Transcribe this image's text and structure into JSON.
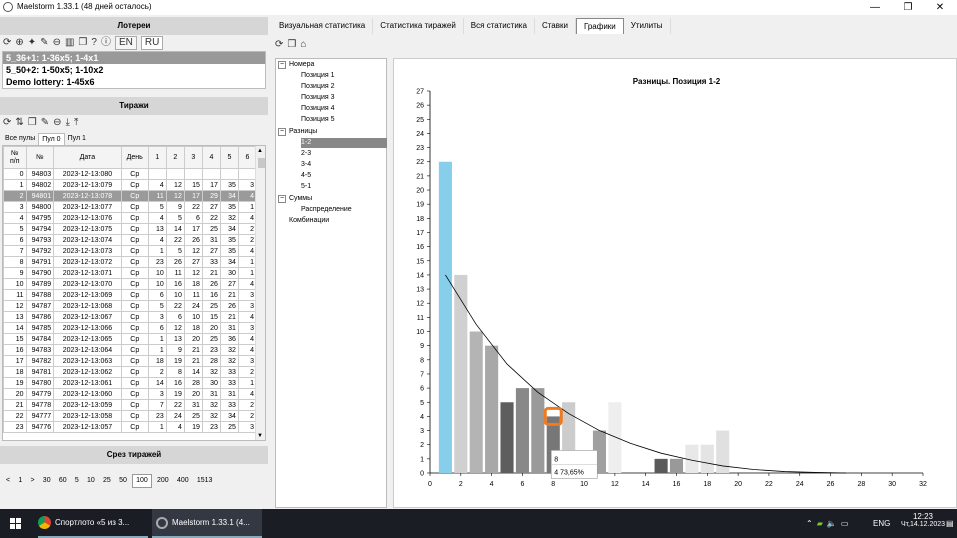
{
  "window": {
    "title": "Maelstorm 1.33.1 (48 дней осталось)",
    "min": "—",
    "max": "❐",
    "close": "✕"
  },
  "left": {
    "lotteries_header": "Лотереи",
    "lang_en": "EN",
    "lang_ru": "RU",
    "lotteries": [
      "5_36+1: 1-36x5; 1-4x1",
      "5_50+2: 1-50x5; 1-10x2",
      "Demo lottery: 1-45x6"
    ],
    "draws_header": "Тиражи",
    "pools": [
      "Все пулы",
      "Пул 0",
      "Пул 1"
    ],
    "columns": [
      "№\nп/п",
      "№",
      "Дата",
      "День",
      "1",
      "2",
      "3",
      "4",
      "5",
      "6"
    ],
    "rows": [
      [
        "0",
        "94803",
        "2023-12-13:080",
        "Ср",
        "",
        "",
        "",
        "",
        "",
        ""
      ],
      [
        "1",
        "94802",
        "2023-12-13:079",
        "Ср",
        "4",
        "12",
        "15",
        "17",
        "35",
        "3"
      ],
      [
        "2",
        "94801",
        "2023-12-13:078",
        "Ср",
        "11",
        "12",
        "17",
        "29",
        "34",
        "4"
      ],
      [
        "3",
        "94800",
        "2023-12-13:077",
        "Ср",
        "5",
        "9",
        "22",
        "27",
        "35",
        "1"
      ],
      [
        "4",
        "94795",
        "2023-12-13:076",
        "Ср",
        "4",
        "5",
        "6",
        "22",
        "32",
        "4"
      ],
      [
        "5",
        "94794",
        "2023-12-13:075",
        "Ср",
        "13",
        "14",
        "17",
        "25",
        "34",
        "2"
      ],
      [
        "6",
        "94793",
        "2023-12-13:074",
        "Ср",
        "4",
        "22",
        "26",
        "31",
        "35",
        "2"
      ],
      [
        "7",
        "94792",
        "2023-12-13:073",
        "Ср",
        "1",
        "5",
        "12",
        "27",
        "35",
        "4"
      ],
      [
        "8",
        "94791",
        "2023-12-13:072",
        "Ср",
        "23",
        "26",
        "27",
        "33",
        "34",
        "1"
      ],
      [
        "9",
        "94790",
        "2023-12-13:071",
        "Ср",
        "10",
        "11",
        "12",
        "21",
        "30",
        "1"
      ],
      [
        "10",
        "94789",
        "2023-12-13:070",
        "Ср",
        "10",
        "16",
        "18",
        "26",
        "27",
        "4"
      ],
      [
        "11",
        "94788",
        "2023-12-13:069",
        "Ср",
        "6",
        "10",
        "11",
        "16",
        "21",
        "3"
      ],
      [
        "12",
        "94787",
        "2023-12-13:068",
        "Ср",
        "5",
        "22",
        "24",
        "25",
        "26",
        "3"
      ],
      [
        "13",
        "94786",
        "2023-12-13:067",
        "Ср",
        "3",
        "6",
        "10",
        "15",
        "21",
        "4"
      ],
      [
        "14",
        "94785",
        "2023-12-13:066",
        "Ср",
        "6",
        "12",
        "18",
        "20",
        "31",
        "3"
      ],
      [
        "15",
        "94784",
        "2023-12-13:065",
        "Ср",
        "1",
        "13",
        "20",
        "25",
        "36",
        "4"
      ],
      [
        "16",
        "94783",
        "2023-12-13:064",
        "Ср",
        "1",
        "9",
        "21",
        "23",
        "32",
        "4"
      ],
      [
        "17",
        "94782",
        "2023-12-13:063",
        "Ср",
        "18",
        "19",
        "21",
        "28",
        "32",
        "3"
      ],
      [
        "18",
        "94781",
        "2023-12-13:062",
        "Ср",
        "2",
        "8",
        "14",
        "32",
        "33",
        "2"
      ],
      [
        "19",
        "94780",
        "2023-12-13:061",
        "Ср",
        "14",
        "16",
        "28",
        "30",
        "33",
        "1"
      ],
      [
        "20",
        "94779",
        "2023-12-13:060",
        "Ср",
        "3",
        "19",
        "20",
        "31",
        "31",
        "4"
      ],
      [
        "21",
        "94778",
        "2023-12-13:059",
        "Ср",
        "7",
        "22",
        "31",
        "32",
        "33",
        "2"
      ],
      [
        "22",
        "94777",
        "2023-12-13:058",
        "Ср",
        "23",
        "24",
        "25",
        "32",
        "34",
        "2"
      ],
      [
        "23",
        "94776",
        "2023-12-13:057",
        "Ср",
        "1",
        "4",
        "19",
        "23",
        "25",
        "3"
      ]
    ],
    "cut_header": "Срез тиражей",
    "pager": [
      "<",
      "1",
      ">",
      "30",
      "60",
      "5",
      "10",
      "25",
      "50",
      "100",
      "200",
      "400",
      "1513"
    ]
  },
  "tabs": [
    "Визуальная статистика",
    "Статистика тиражей",
    "Вся статистика",
    "Ставки",
    "Графики",
    "Утилиты"
  ],
  "tree": {
    "numbers": "Номера",
    "positions": [
      "Позиция 1",
      "Позиция 2",
      "Позиция 3",
      "Позиция 4",
      "Позиция 5"
    ],
    "diffs": "Разницы",
    "diff_items": [
      "1-2",
      "2-3",
      "3-4",
      "4-5",
      "5-1"
    ],
    "sums": "Суммы",
    "distribution": "Распределение",
    "combinations": "Комбинации",
    "expand": "−"
  },
  "chart_data": {
    "type": "bar",
    "title": "Разницы. Позиция 1-2",
    "x": [
      1,
      2,
      3,
      4,
      5,
      6,
      7,
      8,
      9,
      10,
      11,
      12,
      13,
      14,
      15,
      16,
      17,
      18,
      19
    ],
    "values": [
      22,
      14,
      10,
      9,
      5,
      6,
      6,
      4,
      5,
      0,
      3,
      5,
      0,
      0,
      1,
      1,
      2,
      2,
      3
    ],
    "xlim": [
      0,
      32
    ],
    "ylim": [
      0,
      27
    ],
    "xticks": [
      0,
      2,
      4,
      6,
      8,
      10,
      12,
      14,
      16,
      18,
      20,
      22,
      24,
      26,
      28,
      30,
      32
    ],
    "yticks": [
      0,
      1,
      2,
      3,
      4,
      5,
      6,
      7,
      8,
      9,
      10,
      11,
      12,
      13,
      14,
      15,
      16,
      17,
      18,
      19,
      20,
      21,
      22,
      23,
      24,
      25,
      26,
      27
    ],
    "trend": [
      [
        1,
        14
      ],
      [
        3,
        10.5
      ],
      [
        5,
        7.7
      ],
      [
        7,
        5.7
      ],
      [
        9,
        4.2
      ],
      [
        11,
        3.0
      ],
      [
        13,
        2.1
      ],
      [
        15,
        1.4
      ],
      [
        17,
        0.9
      ],
      [
        19,
        0.5
      ],
      [
        21,
        0.25
      ],
      [
        23,
        0.1
      ],
      [
        25,
        0.04
      ],
      [
        27,
        0
      ]
    ],
    "highlight_x": 8,
    "tooltip": {
      "line1": "8",
      "line2": "4 73,65%"
    },
    "colors": {
      "highlight": "#87ceeb",
      "trend": "#000000"
    }
  },
  "taskbar": {
    "chrome_label": "Спортлото «5 из 3...",
    "app_label": "Maelstorm 1.33.1 (4...",
    "lang": "ENG",
    "time": "12:23",
    "date": "Чт,14.12.2023"
  }
}
